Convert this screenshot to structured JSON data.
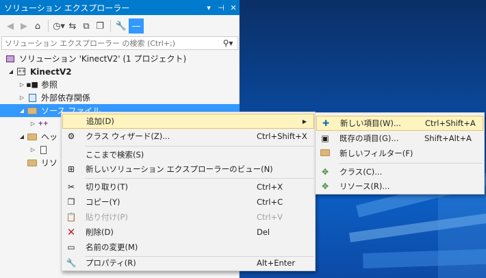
{
  "panel": {
    "title": "ソリューション エクスプローラー",
    "title_buttons": [
      "▾",
      "⊣",
      "✕"
    ]
  },
  "toolbar": {
    "icons": [
      "back-icon",
      "forward-icon",
      "home-icon",
      "history-icon",
      "sync-icon",
      "collapse-all-icon",
      "show-all-files-icon",
      "properties-icon",
      "preview-icon"
    ]
  },
  "search": {
    "placeholder": "ソリューション エクスプローラー の検索 (Ctrl+;)"
  },
  "tree": {
    "solution": "ソリューション 'KinectV2' (1 プロジェクト)",
    "project": "KinectV2",
    "references": "参照",
    "external": "外部依存関係",
    "source_files": "ソース ファイル",
    "headers": "ヘッ",
    "resources": "リソ"
  },
  "context_menu": {
    "items": [
      {
        "label": "追加(D)",
        "shortcut": "",
        "icon": "none"
      },
      {
        "label": "クラス ウィザード(Z)...",
        "shortcut": "Ctrl+Shift+X",
        "icon": "class-wizard-icon"
      },
      {
        "label": "ここまで検索(S)",
        "shortcut": "",
        "icon": "none"
      },
      {
        "label": "新しいソリューション エクスプローラーのビュー(N)",
        "shortcut": "",
        "icon": "new-view-icon"
      },
      {
        "label": "切り取り(T)",
        "shortcut": "Ctrl+X",
        "icon": "cut-icon"
      },
      {
        "label": "コピー(Y)",
        "shortcut": "Ctrl+C",
        "icon": "copy-icon"
      },
      {
        "label": "貼り付け(P)",
        "shortcut": "Ctrl+V",
        "icon": "paste-icon"
      },
      {
        "label": "削除(D)",
        "shortcut": "Del",
        "icon": "delete-icon"
      },
      {
        "label": "名前の変更(M)",
        "shortcut": "",
        "icon": "rename-icon"
      },
      {
        "label": "プロパティ(R)",
        "shortcut": "Alt+Enter",
        "icon": "wrench-icon"
      }
    ]
  },
  "submenu": {
    "items": [
      {
        "label": "新しい項目(W)...",
        "shortcut": "Ctrl+Shift+A"
      },
      {
        "label": "既存の項目(G)...",
        "shortcut": "Shift+Alt+A"
      },
      {
        "label": "新しいフィルター(F)",
        "shortcut": ""
      },
      {
        "label": "クラス(C)...",
        "shortcut": ""
      },
      {
        "label": "リソース(R)...",
        "shortcut": ""
      }
    ]
  },
  "colors": {
    "accent": "#007acc",
    "selection": "#3399ff",
    "menu_bg": "#f2f2f2",
    "highlight": "#fdf4bf"
  }
}
